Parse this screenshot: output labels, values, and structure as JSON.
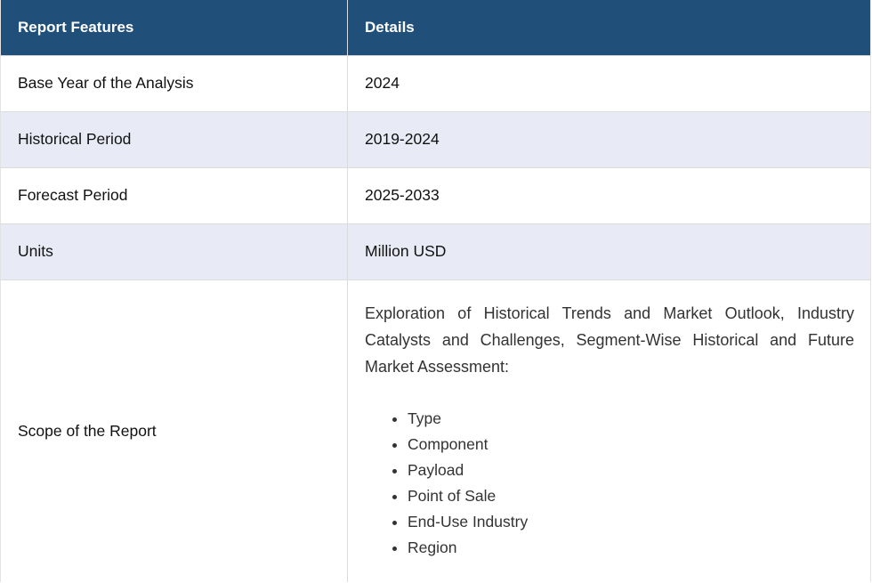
{
  "table": {
    "headers": [
      "Report Features",
      "Details"
    ],
    "rows": [
      {
        "feature": "Base Year of the Analysis",
        "detail": "2024"
      },
      {
        "feature": "Historical Period",
        "detail": "2019-2024"
      },
      {
        "feature": "Forecast Period",
        "detail": "2025-2033"
      },
      {
        "feature": "Units",
        "detail": "Million USD"
      }
    ],
    "scope": {
      "feature": "Scope of the Report",
      "description": "Exploration of Historical Trends and Market Outlook, Industry Catalysts and Challenges, Segment-Wise Historical and Future Market Assessment:",
      "items": [
        "Type",
        "Component",
        "Payload",
        "Point of Sale",
        "End-Use Industry",
        "Region"
      ]
    }
  },
  "colors": {
    "header_bg": "#20507a",
    "alt_row_bg": "#e8ebf6"
  }
}
